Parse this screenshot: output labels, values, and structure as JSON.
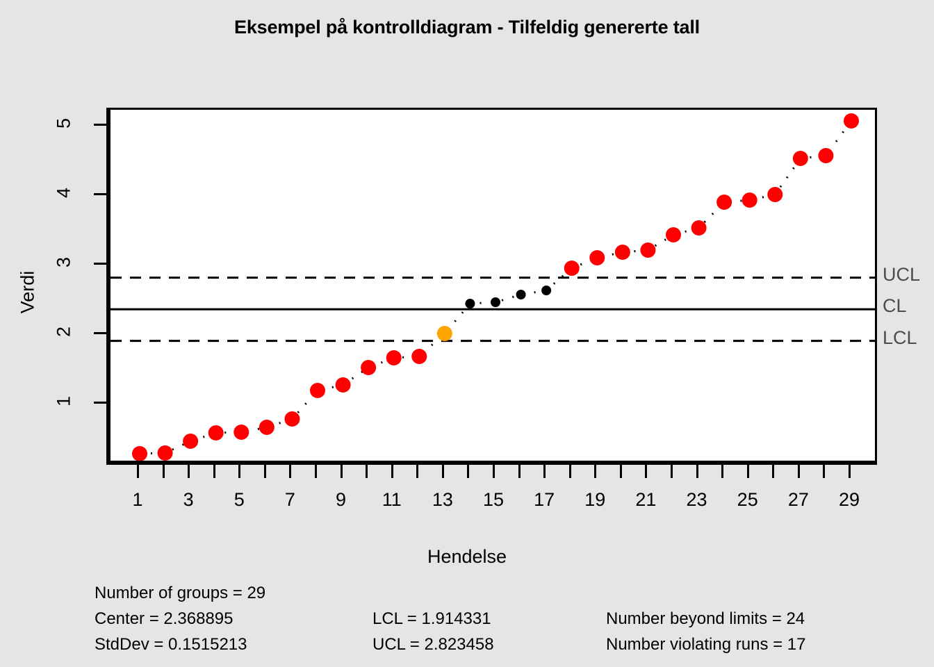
{
  "title": "Eksempel på kontrolldiagram - Tilfeldig genererte tall",
  "axes": {
    "ylabel": "Verdi",
    "xlabel": "Hendelse",
    "yticks": [
      1,
      2,
      3,
      4,
      5
    ],
    "xticks_labeled": [
      1,
      3,
      5,
      7,
      9,
      11,
      13,
      15,
      17,
      19,
      21,
      23,
      25,
      27,
      29
    ]
  },
  "limit_labels": {
    "ucl": "UCL",
    "cl": "CL",
    "lcl": "LCL"
  },
  "colors": {
    "beyond_limits": "#ff0000",
    "violating_runs": "#ffa500",
    "in_control": "#000000",
    "limit_label": "#4d4d4d",
    "background": "#e5e5e5",
    "panel": "#ffffff"
  },
  "stats": {
    "number_of_groups": "Number of groups = 29",
    "center": "Center = 2.368895",
    "stddev": "StdDev = 0.1515213",
    "lcl": "LCL = 1.914331",
    "ucl": "UCL = 2.823458",
    "beyond_limits": "Number beyond limits = 24",
    "violating_runs": "Number violating runs = 17"
  },
  "chart_data": {
    "type": "line",
    "title": "Eksempel på kontrolldiagram - Tilfeldig genererte tall",
    "xlabel": "Hendelse",
    "ylabel": "Verdi",
    "xlim": [
      0.3,
      29.7
    ],
    "ylim": [
      0.13,
      5.27
    ],
    "grid": false,
    "legend": false,
    "center": 2.368895,
    "stddev": 0.1515213,
    "lcl": 1.914331,
    "ucl": 2.823458,
    "number_of_groups": 29,
    "number_beyond_limits": 24,
    "number_violating_runs": 17,
    "x": [
      1,
      2,
      3,
      4,
      5,
      6,
      7,
      8,
      9,
      10,
      11,
      12,
      13,
      14,
      15,
      16,
      17,
      18,
      19,
      20,
      21,
      22,
      23,
      24,
      25,
      26,
      27,
      28,
      29
    ],
    "values": [
      0.29,
      0.3,
      0.47,
      0.59,
      0.6,
      0.67,
      0.79,
      1.2,
      1.28,
      1.53,
      1.67,
      1.69,
      2.02,
      2.45,
      2.47,
      2.58,
      2.64,
      2.96,
      3.11,
      3.19,
      3.22,
      3.44,
      3.54,
      3.91,
      3.94,
      4.02,
      4.54,
      4.58,
      5.08
    ],
    "point_status": [
      "beyond",
      "beyond",
      "beyond",
      "beyond",
      "beyond",
      "beyond",
      "beyond",
      "beyond",
      "beyond",
      "beyond",
      "beyond",
      "beyond",
      "runs",
      "ok",
      "ok",
      "ok",
      "ok",
      "beyond",
      "beyond",
      "beyond",
      "beyond",
      "beyond",
      "beyond",
      "beyond",
      "beyond",
      "beyond",
      "beyond",
      "beyond",
      "beyond"
    ]
  }
}
